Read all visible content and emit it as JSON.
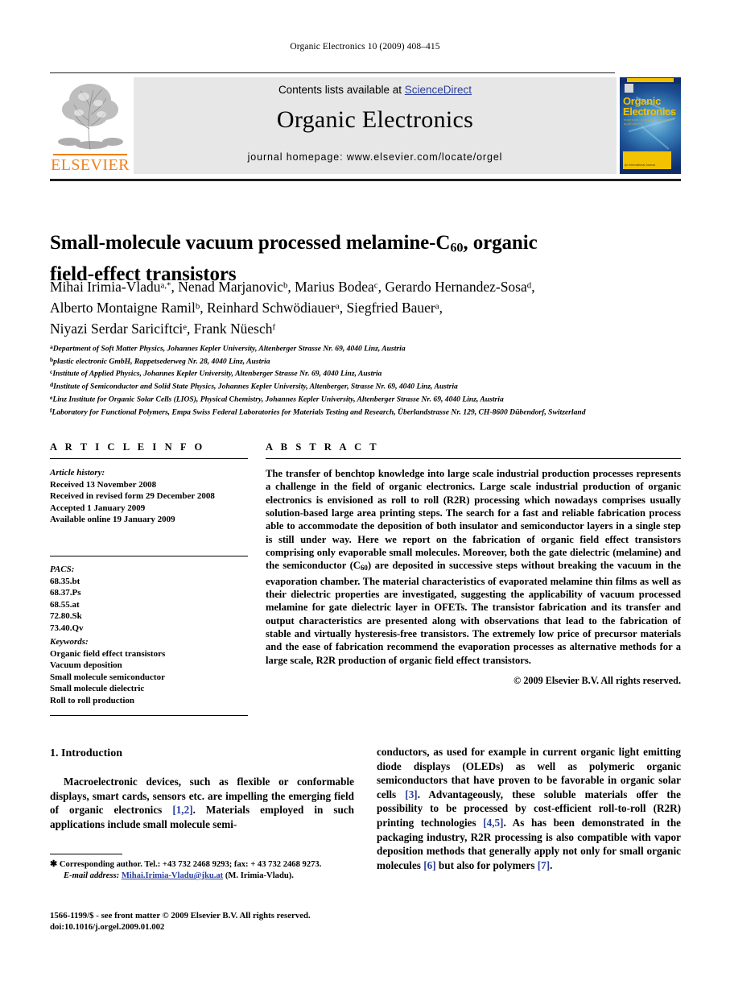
{
  "running_head": "Organic Electronics 10 (2009) 408–415",
  "banner": {
    "contents_prefix": "Contents lists available at ",
    "sciencedirect": "ScienceDirect",
    "journal_title": "Organic Electronics",
    "homepage": "journal homepage: www.elsevier.com/locate/orgel",
    "publisher_wordmark": "ELSEVIER",
    "cover": {
      "line1": "Organic",
      "line2": "Electronics",
      "subtitle": "materials • physics • chemistry • applications",
      "band_text": "An International Journal"
    },
    "colors": {
      "sciencedirect_link": "#2a3f9d",
      "elsevier_orange": "#f07f1a",
      "cover_background": "#0f2f6b",
      "cover_yellow": "#f2c200",
      "banner_background": "#e7e7e7"
    }
  },
  "article": {
    "title_line1_a": "Small-molecule vacuum processed melamine-C",
    "title_sub": "60",
    "title_line1_b": ", organic",
    "title_line2": "field-effect transistors",
    "authors_line1": [
      {
        "name": "Mihai Irimia-Vladu",
        "sup": "a,*",
        "sep": ", "
      },
      {
        "name": "Nenad Marjanovic",
        "sup": "b",
        "sep": ", "
      },
      {
        "name": "Marius Bodea",
        "sup": "c",
        "sep": ", "
      },
      {
        "name": "Gerardo Hernandez-Sosa",
        "sup": "d",
        "sep": ","
      }
    ],
    "authors_line2": [
      {
        "name": "Alberto Montaigne Ramil",
        "sup": "b",
        "sep": ", "
      },
      {
        "name": "Reinhard Schwödiauer",
        "sup": "a",
        "sep": ", "
      },
      {
        "name": "Siegfried Bauer",
        "sup": "a",
        "sep": ","
      }
    ],
    "authors_line3": [
      {
        "name": "Niyazi Serdar Sariciftci",
        "sup": "e",
        "sep": ", "
      },
      {
        "name": "Frank Nüesch",
        "sup": "f",
        "sep": ""
      }
    ],
    "affiliations": [
      {
        "mark": "a",
        "text": "Department of Soft Matter Physics, Johannes Kepler University, Altenberger Strasse Nr. 69, 4040 Linz, Austria"
      },
      {
        "mark": "b",
        "text": "plastic electronic GmbH, Rappetsederweg Nr. 28, 4040 Linz, Austria"
      },
      {
        "mark": "c",
        "text": "Institute of Applied Physics, Johannes Kepler University, Altenberger Strasse Nr. 69, 4040 Linz, Austria"
      },
      {
        "mark": "d",
        "text": "Institute of Semiconductor and Solid State Physics, Johannes Kepler University, Altenberger, Strasse Nr. 69, 4040 Linz, Austria"
      },
      {
        "mark": "e",
        "text": "Linz Institute for Organic Solar Cells (LIOS), Physical Chemistry, Johannes Kepler University, Altenberger Strasse Nr. 69, 4040 Linz, Austria"
      },
      {
        "mark": "f",
        "text": "Laboratory for Functional Polymers, Empa Swiss Federal Laboratories for Materials Testing and Research, Überlandstrasse Nr. 129, CH-8600 Dübendorf, Switzerland"
      }
    ]
  },
  "info": {
    "heading": "A R T I C L E   I N F O",
    "history_label": "Article history:",
    "history": [
      "Received 13 November 2008",
      "Received in revised form 29 December 2008",
      "Accepted 1 January 2009",
      "Available online 19 January 2009"
    ],
    "pacs_label": "PACS:",
    "pacs": [
      "68.35.bt",
      "68.37.Ps",
      "68.55.at",
      "72.80.Sk",
      "73.40.Qv"
    ],
    "keywords_label": "Keywords:",
    "keywords": [
      "Organic field effect transistors",
      "Vacuum deposition",
      "Small molecule semiconductor",
      "Small molecule dielectric",
      "Roll to roll production"
    ]
  },
  "abstract": {
    "heading": "A B S T R A C T",
    "part1": "The transfer of benchtop knowledge into large scale industrial production processes represents a challenge in the field of organic electronics. Large scale industrial production of organic electronics is envisioned as roll to roll (R2R) processing which nowadays comprises usually solution-based large area printing steps. The search for a fast and reliable fabrication process able to accommodate the deposition of both insulator and semiconductor layers in a single step is still under way. Here we report on the fabrication of organic field effect transistors comprising only evaporable small molecules. Moreover, both the gate dielectric (melamine) and the semiconductor (C",
    "sub": "60",
    "part2": ") are deposited in successive steps without breaking the vacuum in the evaporation chamber. The material characteristics of evaporated melamine thin films as well as their dielectric properties are investigated, suggesting the applicability of vacuum processed melamine for gate dielectric layer in OFETs. The transistor fabrication and its transfer and output characteristics are presented along with observations that lead to the fabrication of stable and virtually hysteresis-free transistors. The extremely low price of precursor materials and the ease of fabrication recommend the evaporation processes as alternative methods for a large scale, R2R production of organic field effect transistors.",
    "copyright": "© 2009 Elsevier B.V. All rights reserved."
  },
  "body": {
    "section_heading": "1. Introduction",
    "left_p1_a": "Macroelectronic devices, such as flexible or conformable displays, smart cards, sensors etc. are impelling the emerging field of organic electronics ",
    "left_cite_1": "[1,2]",
    "left_p1_b": ". Materials employed in such applications include small molecule semi-",
    "right_a": "conductors, as used for example in current organic light emitting diode displays (OLEDs) as well as polymeric organic semiconductors that have proven to be favorable in organic solar cells ",
    "right_cite_3": "[3]",
    "right_b": ". Advantageously, these soluble materials offer the possibility to be processed by cost-efficient roll-to-roll (R2R) printing technologies ",
    "right_cite_45": "[4,5]",
    "right_c": ". As has been demonstrated in the packaging industry, R2R processing is also compatible with vapor deposition methods that generally apply not only for small organic molecules ",
    "right_cite_6": "[6]",
    "right_d": " but also for polymers ",
    "right_cite_7": "[7]",
    "right_e": "."
  },
  "footer": {
    "corresponding": "Corresponding author. Tel.: +43 732 2468 9293; fax: + 43 732 2468 9273.",
    "email_label": "E-mail address:",
    "email": "Mihai.Irimia-Vladu@jku.at",
    "email_owner": "(M. Irimia-Vladu).",
    "issn_line": "1566-1199/$ - see front matter © 2009 Elsevier B.V. All rights reserved.",
    "doi_line": "doi:10.1016/j.orgel.2009.01.002"
  }
}
